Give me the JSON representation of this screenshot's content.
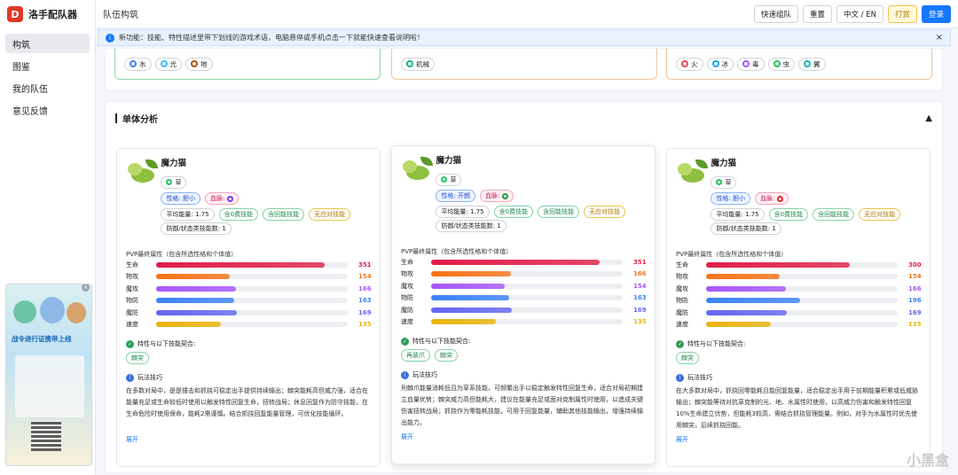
{
  "app": {
    "name": "洛手配队器",
    "logo_char": "D"
  },
  "sidebar": {
    "items": [
      {
        "label": "构筑"
      },
      {
        "label": "图鉴"
      },
      {
        "label": "我的队伍"
      },
      {
        "label": "意见反馈"
      }
    ]
  },
  "topbar": {
    "title": "队伍构筑",
    "quick_team": "快速组队",
    "reset": "重置",
    "lang": "中文 / EN",
    "sponsor": "打赏",
    "login": "登录"
  },
  "notice": {
    "text": "新功能：技能、特性描述里带下划线的游戏术语，电脑悬停或手机点击一下就能快速查看说明啦！",
    "close": "×"
  },
  "type_panels": [
    {
      "color": "#8fd3a8",
      "chips": [
        {
          "label": "水",
          "color": "#3b82f6"
        },
        {
          "label": "光",
          "color": "#38bdf8"
        },
        {
          "label": "地",
          "color": "#b45309"
        }
      ]
    },
    {
      "color": "#f5c49a",
      "chips": [
        {
          "label": "机械",
          "color": "#10b981"
        }
      ]
    },
    {
      "color": "#f5c49a",
      "chips": [
        {
          "label": "火",
          "color": "#ef4444"
        },
        {
          "label": "冰",
          "color": "#0ea5e9"
        },
        {
          "label": "毒",
          "color": "#a855f7"
        },
        {
          "label": "虫",
          "color": "#22c55e"
        },
        {
          "label": "翼",
          "color": "#14b8a6"
        }
      ]
    }
  ],
  "analysis": {
    "title": "单体分析",
    "collapse_icon": "▲",
    "stat_title": "PVP最终属性（包含所选性格和个体值）",
    "traits_title": "特性与以下技能契合:",
    "tips_title": "玩法技巧",
    "expand": "展开",
    "cards": [
      {
        "name": "魔力猫",
        "type": "草",
        "nature": "性格: 胆小",
        "bloodline": "血脉:",
        "bloodline_color": "#7c3aed",
        "tags": [
          "平均能量: 1.75",
          "含0费技能",
          "含回能技能",
          "无应对技能"
        ],
        "tag2": "防御/状态类技能数: 1",
        "stats": [
          {
            "label": "生命",
            "value": 351
          },
          {
            "label": "物攻",
            "value": 154
          },
          {
            "label": "魔攻",
            "value": 166
          },
          {
            "label": "物防",
            "value": 163
          },
          {
            "label": "魔防",
            "value": 169
          },
          {
            "label": "速度",
            "value": 135
          }
        ],
        "skills": [
          "棘突"
        ],
        "tips": "在多数对局中，是是撞击和抓挠可稳定出手提供持续输出；棘突能耗高但威力强，适合在能量充足或生命较低时使用以触发特性回复生命，扭转战局；休息回复作为防守技能，在生命危险时使用保命，能耗2需谨慎。结合抓挠回复能量管理，可优化技能循环。"
      },
      {
        "name": "魔力猫",
        "type": "草",
        "nature": "性格: 开朗",
        "bloodline": "血脉:",
        "bloodline_color": "#16a34a",
        "tags": [
          "平均能量: 1.75",
          "含0费技能",
          "含回能技能",
          "无应对技能"
        ],
        "tag2": "防御/状态类技能数: 1",
        "stats": [
          {
            "label": "生命",
            "value": 351
          },
          {
            "label": "物攻",
            "value": 166
          },
          {
            "label": "魔攻",
            "value": 154
          },
          {
            "label": "物防",
            "value": 163
          },
          {
            "label": "魔防",
            "value": 169
          },
          {
            "label": "速度",
            "value": 135
          }
        ],
        "skills": [
          "再装爪",
          "棘突"
        ],
        "tips": "刑棘爪能量消耗低且为草系技能，可频繁出手以稳定触发特性回复生命，适合对局初期建立血量优势；棘突威力高但能耗大，建议在能量充足或面对克制属性时使用，以造成关键伤害扭转战局；抓挠作为零能耗技能，可用于回复能量，辅助其他技能输出，增强持续输出能力。"
      },
      {
        "name": "魔力猫",
        "type": "草",
        "nature": "性格: 胆小",
        "bloodline": "血脉:",
        "bloodline_color": "#dc2626",
        "tags": [
          "平均能量: 1.75",
          "含0费技能",
          "含回能技能",
          "无应对技能"
        ],
        "tag2": "防御/状态类技能数: 1",
        "stats": [
          {
            "label": "生命",
            "value": 300
          },
          {
            "label": "物攻",
            "value": 154
          },
          {
            "label": "魔攻",
            "value": 166
          },
          {
            "label": "物防",
            "value": 196
          },
          {
            "label": "魔防",
            "value": 169
          },
          {
            "label": "速度",
            "value": 135
          }
        ],
        "skills": [
          "棘突"
        ],
        "tips": "在大多数对局中，抓挠回零能耗且能回复能量，适合稳定出手用于前期能量积累或低威胁输出；棘突能等待对抗草克制的光、地、水属性时使用，以高威力伤害和触发特性回复10%生命建立优势，但能耗3较高，需结合抓挠管理能量。例如，对手为水属性时优先使用棘突，后续抓挠回能。"
      }
    ]
  },
  "stat_colors": [
    "#e11d48",
    "#f97316",
    "#a855f7",
    "#3b82f6",
    "#6366f1",
    "#eab308"
  ],
  "stat_max": 400,
  "ad": {
    "headline": "战令进行证携带上线"
  },
  "watermark": "小黑盒"
}
